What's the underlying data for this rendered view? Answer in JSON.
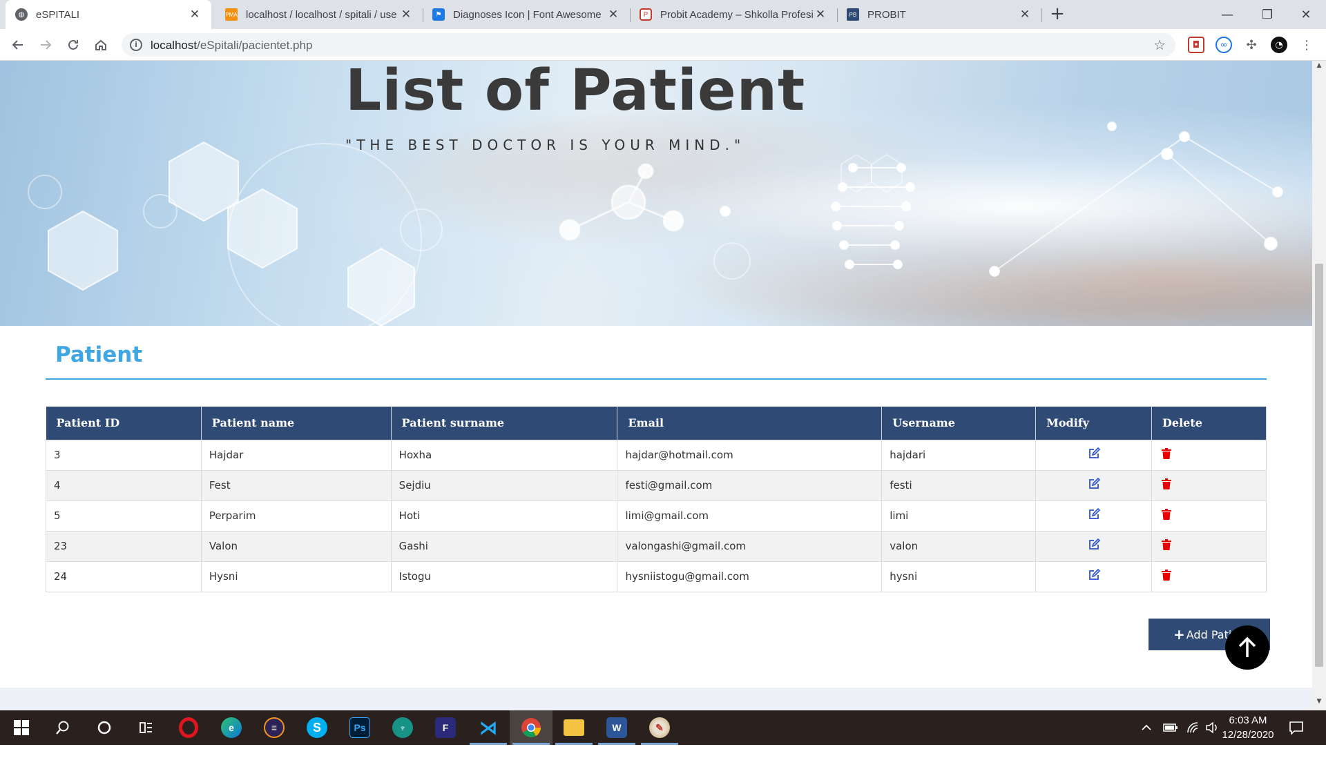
{
  "browser": {
    "tabs": [
      {
        "title": "eSPITALI",
        "active": true,
        "favicon": "globe-icon"
      },
      {
        "title": "localhost / localhost / spitali / use",
        "active": false,
        "favicon": "phpmyadmin-icon"
      },
      {
        "title": "Diagnoses Icon | Font Awesome",
        "active": false,
        "favicon": "font-awesome-icon"
      },
      {
        "title": "Probit Academy – Shkolla Profesi",
        "active": false,
        "favicon": "probit-shield-icon"
      },
      {
        "title": "PROBIT",
        "active": false,
        "favicon": "probit-logo-icon"
      }
    ],
    "url_host": "localhost",
    "url_path": "/eSpitali/pacientet.php"
  },
  "hero": {
    "title": "List of Patient",
    "quote": "\"THE BEST DOCTOR IS YOUR MIND.\""
  },
  "section": {
    "title": "Patient"
  },
  "table": {
    "headers": [
      "Patient ID",
      "Patient name",
      "Patient surname",
      "Email",
      "Username",
      "Modify",
      "Delete"
    ],
    "rows": [
      {
        "id": "3",
        "name": "Hajdar",
        "surname": "Hoxha",
        "email": "hajdar@hotmail.com",
        "username": "hajdari"
      },
      {
        "id": "4",
        "name": "Fest",
        "surname": "Sejdiu",
        "email": "festi@gmail.com",
        "username": "festi"
      },
      {
        "id": "5",
        "name": "Perparim",
        "surname": "Hoti",
        "email": "limi@gmail.com",
        "username": "limi"
      },
      {
        "id": "23",
        "name": "Valon",
        "surname": "Gashi",
        "email": "valongashi@gmail.com",
        "username": "valon"
      },
      {
        "id": "24",
        "name": "Hysni",
        "surname": "Istogu",
        "email": "hysniistogu@gmail.com",
        "username": "hysni"
      }
    ]
  },
  "actions": {
    "add_label": "Add Patient"
  },
  "colors": {
    "accent": "#3ea6e0",
    "table_header": "#2f4a74",
    "delete_icon": "#e60000",
    "edit_icon": "#2b4fd6"
  },
  "taskbar": {
    "apps": [
      "start-icon",
      "search-icon",
      "cortana-icon",
      "task-view-icon",
      "opera-icon",
      "edge-icon",
      "eclipse-icon",
      "skype-icon",
      "photoshop-icon",
      "gitkraken-icon",
      "app-f-icon",
      "vscode-icon",
      "chrome-icon",
      "file-explorer-icon",
      "word-icon",
      "paint-icon"
    ],
    "time": "6:03 AM",
    "date": "12/28/2020"
  }
}
